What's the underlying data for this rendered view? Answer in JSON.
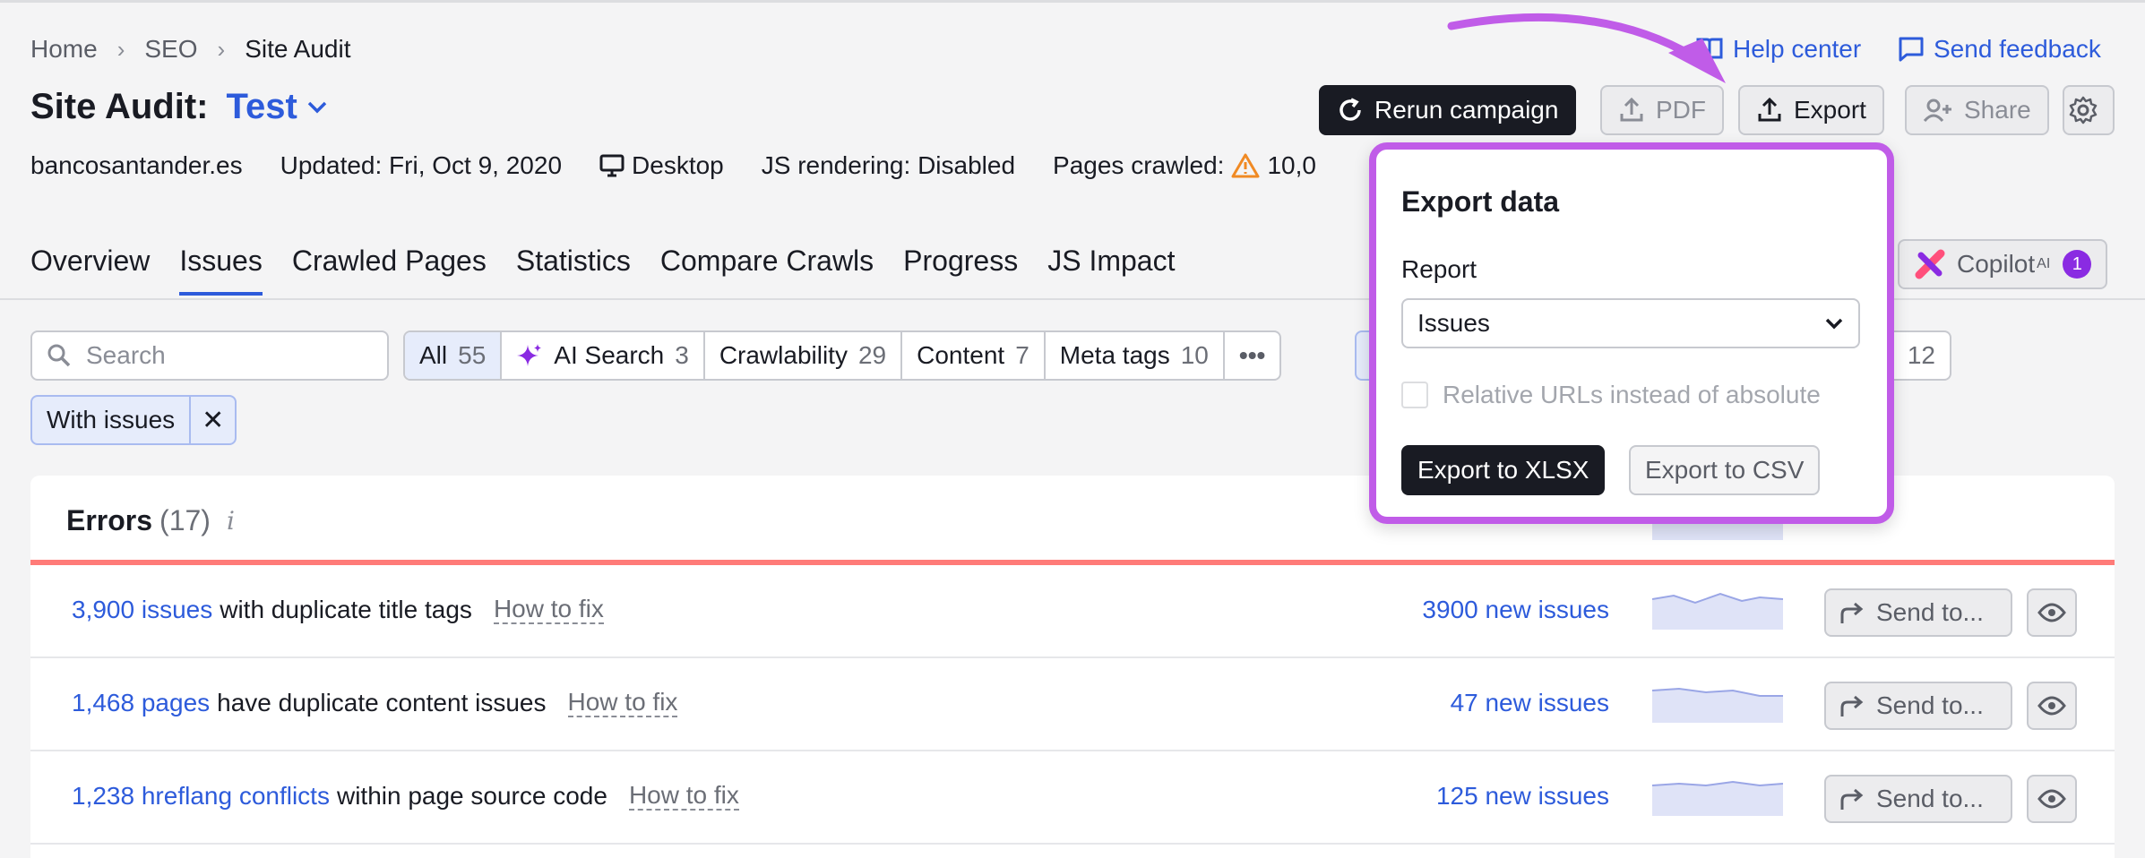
{
  "breadcrumb": {
    "home": "Home",
    "seo": "SEO",
    "current": "Site Audit"
  },
  "title": {
    "prefix": "Site Audit:",
    "project": "Test"
  },
  "meta": {
    "domain": "bancosantander.es",
    "updated": "Updated: Fri, Oct 9, 2020",
    "device": "Desktop",
    "js": "JS rendering: Disabled",
    "pages": "Pages crawled:",
    "pages_value": "10,0"
  },
  "toplinks": {
    "help": "Help center",
    "feedback": "Send feedback"
  },
  "toolbar": {
    "rerun": "Rerun campaign",
    "pdf": "PDF",
    "export": "Export",
    "share": "Share"
  },
  "tabs": [
    "Overview",
    "Issues",
    "Crawled Pages",
    "Statistics",
    "Compare Crawls",
    "Progress",
    "JS Impact"
  ],
  "copilot": {
    "label": "Copilot",
    "sup": "AI",
    "badge": "1"
  },
  "search": {
    "placeholder": "Search"
  },
  "filters": [
    {
      "label": "All",
      "count": "55"
    },
    {
      "label": "AI Search",
      "count": "3"
    },
    {
      "label": "Crawlability",
      "count": "29"
    },
    {
      "label": "Content",
      "count": "7"
    },
    {
      "label": "Meta tags",
      "count": "10"
    },
    {
      "label": "•••",
      "count": ""
    }
  ],
  "hidden_filter_count": "12",
  "chip": {
    "label": "With issues",
    "close": "✕"
  },
  "errors": {
    "title": "Errors",
    "count": "(17)",
    "info": "i"
  },
  "rows": [
    {
      "link": "3,900 issues",
      "text": "with duplicate title tags",
      "fix": "How to fix",
      "new": "3900 new issues",
      "send": "Send to..."
    },
    {
      "link": "1,468 pages",
      "text": "have duplicate content issues",
      "fix": "How to fix",
      "new": "47 new issues",
      "send": "Send to..."
    },
    {
      "link": "1,238 hreflang conflicts",
      "text": "within page source code",
      "fix": "How to fix",
      "new": "125 new issues",
      "send": "Send to..."
    }
  ],
  "popup": {
    "title": "Export data",
    "report_label": "Report",
    "report_value": "Issues",
    "checkbox": "Relative URLs instead of absolute",
    "xlsx": "Export to XLSX",
    "csv": "Export to CSV"
  },
  "colors": {
    "accent": "#2d5bdb",
    "highlight": "#c05ce8",
    "error": "#ff7b78"
  }
}
